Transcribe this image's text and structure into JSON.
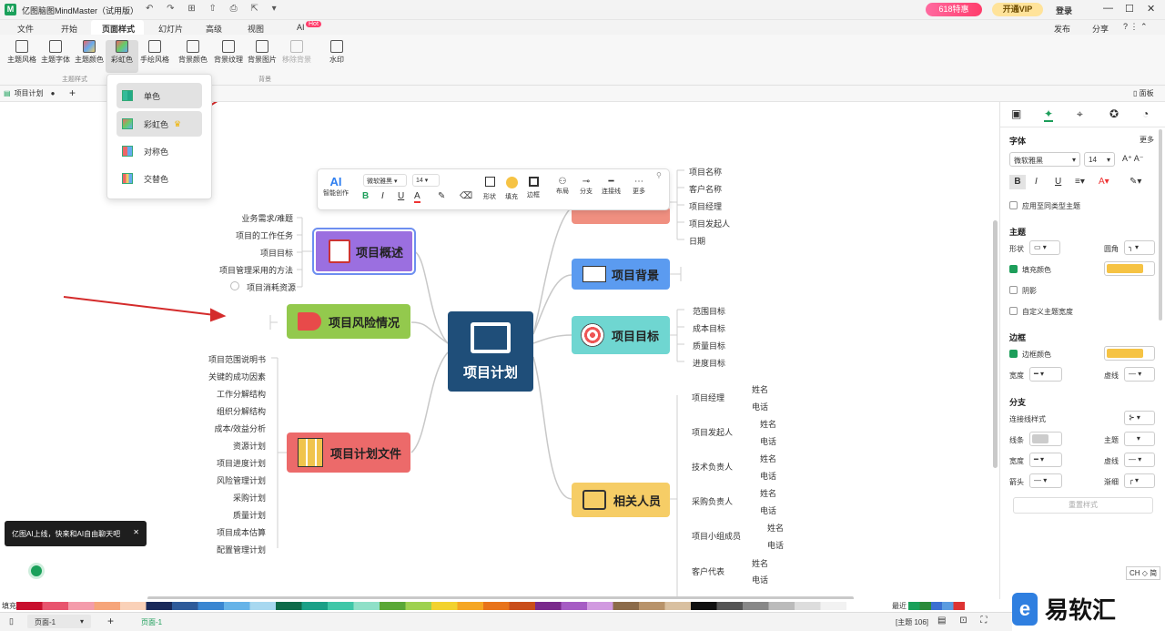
{
  "app": {
    "title": "亿图脑图MindMaster（试用版）",
    "logo_color": "#1aa05a"
  },
  "titlebar": {
    "promo": "618特惠",
    "vip": "开通VIP",
    "login": "登录",
    "publish": "发布",
    "share": "分享"
  },
  "menu": [
    "文件",
    "开始",
    "页面样式",
    "幻灯片",
    "高级",
    "视图",
    "AI"
  ],
  "menu_ai_badge": "Hot",
  "ribbon": {
    "group1_buttons": [
      "主题风格",
      "主题字体",
      "主题颜色",
      "彩虹色",
      "手绘风格"
    ],
    "group1_label": "主题样式",
    "group2_buttons": [
      "背景颜色",
      "背景纹理",
      "背景图片",
      "移除背景"
    ],
    "group2_label": "背景",
    "watermark": "水印"
  },
  "doctab": {
    "name": "项目计划",
    "panel": "面板"
  },
  "dropdown": [
    "单色",
    "彩虹色",
    "对称色",
    "交替色"
  ],
  "floating_toolbar": {
    "ai_label": "智能创作",
    "font": "微软雅黑",
    "size": "14",
    "tools": [
      "形状",
      "填充",
      "边框",
      "布局",
      "分支",
      "连接线",
      "更多"
    ]
  },
  "center": {
    "label": "项目计划",
    "color": "#1f4e79"
  },
  "branches": {
    "overview": {
      "label": "项目概述",
      "color": "#9b6fe0",
      "children": [
        "业务需求/难题",
        "项目的工作任务",
        "项目目标",
        "项目管理采用的方法",
        "项目消耗资源"
      ]
    },
    "risk": {
      "label": "项目风险情况",
      "color": "#93c94d"
    },
    "docs": {
      "label": "项目计划文件",
      "color": "#ec6a6a",
      "children": [
        "项目范围说明书",
        "关键的成功因素",
        "工作分解结构",
        "组织分解结构",
        "成本/效益分析",
        "资源计划",
        "项目进度计划",
        "风险管理计划",
        "采购计划",
        "质量计划",
        "项目成本估算",
        "配置管理计划"
      ]
    },
    "info": {
      "color": "#f08f80",
      "children": [
        "项目名称",
        "客户名称",
        "项目经理",
        "项目发起人",
        "日期"
      ]
    },
    "background": {
      "label": "项目背景",
      "color": "#5b9bf0"
    },
    "goals": {
      "label": "项目目标",
      "color": "#6fd6d1",
      "children": [
        "范围目标",
        "成本目标",
        "质量目标",
        "进度目标"
      ]
    },
    "people": {
      "label": "相关人员",
      "color": "#f6cd66",
      "roles": [
        "项目经理",
        "项目发起人",
        "技术负责人",
        "采购负责人",
        "项目小组成员",
        "客户代表"
      ],
      "sub": [
        "姓名",
        "电话"
      ]
    }
  },
  "rightpanel": {
    "font_title": "字体",
    "more": "更多",
    "font": "微软雅黑",
    "size": "14",
    "apply_same": "应用至同类型主题",
    "theme_title": "主题",
    "shape": "形状",
    "corner": "圆角",
    "fill": "填充颜色",
    "shadow": "阴影",
    "custom_width": "自定义主题宽度",
    "border_title": "边框",
    "border_color": "边框颜色",
    "width": "宽度",
    "dash": "虚线",
    "branch_title": "分支",
    "line_style": "连接线样式",
    "line": "线条",
    "topic": "主题",
    "arrow": "箭头",
    "taper": "渐细",
    "reset": "重置样式",
    "accent_fill": "#f6c344"
  },
  "ai_tip": "亿图AI上线，快来和AI自由聊天吧",
  "palette_label": "填充",
  "recent_label": "最近",
  "ime": "CH ◇ 简",
  "status": {
    "page": "页面-1",
    "page_tab": "页面-1",
    "topic_count": "[主题 106]"
  },
  "watermark_logo": "易软汇"
}
